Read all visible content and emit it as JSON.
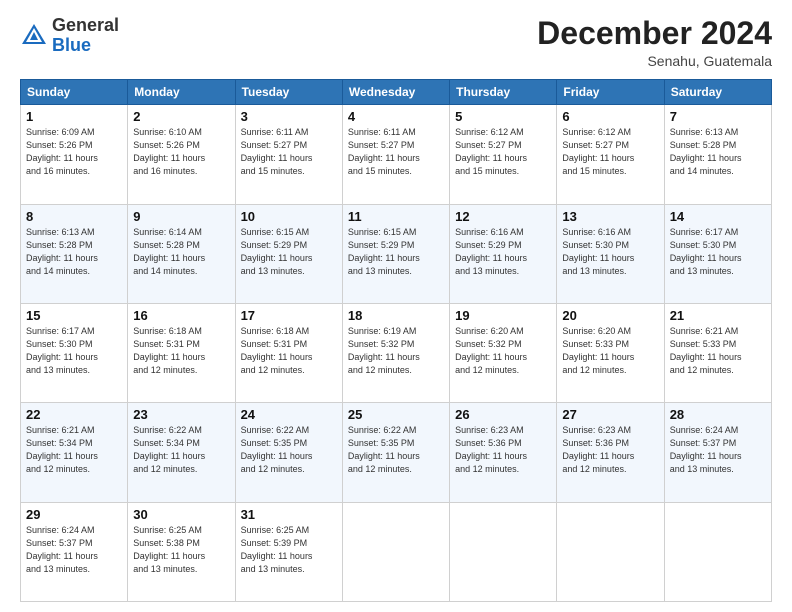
{
  "logo": {
    "general": "General",
    "blue": "Blue"
  },
  "header": {
    "title": "December 2024",
    "location": "Senahu, Guatemala"
  },
  "weekdays": [
    "Sunday",
    "Monday",
    "Tuesday",
    "Wednesday",
    "Thursday",
    "Friday",
    "Saturday"
  ],
  "weeks": [
    [
      {
        "day": "1",
        "info": "Sunrise: 6:09 AM\nSunset: 5:26 PM\nDaylight: 11 hours\nand 16 minutes."
      },
      {
        "day": "2",
        "info": "Sunrise: 6:10 AM\nSunset: 5:26 PM\nDaylight: 11 hours\nand 16 minutes."
      },
      {
        "day": "3",
        "info": "Sunrise: 6:11 AM\nSunset: 5:27 PM\nDaylight: 11 hours\nand 15 minutes."
      },
      {
        "day": "4",
        "info": "Sunrise: 6:11 AM\nSunset: 5:27 PM\nDaylight: 11 hours\nand 15 minutes."
      },
      {
        "day": "5",
        "info": "Sunrise: 6:12 AM\nSunset: 5:27 PM\nDaylight: 11 hours\nand 15 minutes."
      },
      {
        "day": "6",
        "info": "Sunrise: 6:12 AM\nSunset: 5:27 PM\nDaylight: 11 hours\nand 15 minutes."
      },
      {
        "day": "7",
        "info": "Sunrise: 6:13 AM\nSunset: 5:28 PM\nDaylight: 11 hours\nand 14 minutes."
      }
    ],
    [
      {
        "day": "8",
        "info": "Sunrise: 6:13 AM\nSunset: 5:28 PM\nDaylight: 11 hours\nand 14 minutes."
      },
      {
        "day": "9",
        "info": "Sunrise: 6:14 AM\nSunset: 5:28 PM\nDaylight: 11 hours\nand 14 minutes."
      },
      {
        "day": "10",
        "info": "Sunrise: 6:15 AM\nSunset: 5:29 PM\nDaylight: 11 hours\nand 13 minutes."
      },
      {
        "day": "11",
        "info": "Sunrise: 6:15 AM\nSunset: 5:29 PM\nDaylight: 11 hours\nand 13 minutes."
      },
      {
        "day": "12",
        "info": "Sunrise: 6:16 AM\nSunset: 5:29 PM\nDaylight: 11 hours\nand 13 minutes."
      },
      {
        "day": "13",
        "info": "Sunrise: 6:16 AM\nSunset: 5:30 PM\nDaylight: 11 hours\nand 13 minutes."
      },
      {
        "day": "14",
        "info": "Sunrise: 6:17 AM\nSunset: 5:30 PM\nDaylight: 11 hours\nand 13 minutes."
      }
    ],
    [
      {
        "day": "15",
        "info": "Sunrise: 6:17 AM\nSunset: 5:30 PM\nDaylight: 11 hours\nand 13 minutes."
      },
      {
        "day": "16",
        "info": "Sunrise: 6:18 AM\nSunset: 5:31 PM\nDaylight: 11 hours\nand 12 minutes."
      },
      {
        "day": "17",
        "info": "Sunrise: 6:18 AM\nSunset: 5:31 PM\nDaylight: 11 hours\nand 12 minutes."
      },
      {
        "day": "18",
        "info": "Sunrise: 6:19 AM\nSunset: 5:32 PM\nDaylight: 11 hours\nand 12 minutes."
      },
      {
        "day": "19",
        "info": "Sunrise: 6:20 AM\nSunset: 5:32 PM\nDaylight: 11 hours\nand 12 minutes."
      },
      {
        "day": "20",
        "info": "Sunrise: 6:20 AM\nSunset: 5:33 PM\nDaylight: 11 hours\nand 12 minutes."
      },
      {
        "day": "21",
        "info": "Sunrise: 6:21 AM\nSunset: 5:33 PM\nDaylight: 11 hours\nand 12 minutes."
      }
    ],
    [
      {
        "day": "22",
        "info": "Sunrise: 6:21 AM\nSunset: 5:34 PM\nDaylight: 11 hours\nand 12 minutes."
      },
      {
        "day": "23",
        "info": "Sunrise: 6:22 AM\nSunset: 5:34 PM\nDaylight: 11 hours\nand 12 minutes."
      },
      {
        "day": "24",
        "info": "Sunrise: 6:22 AM\nSunset: 5:35 PM\nDaylight: 11 hours\nand 12 minutes."
      },
      {
        "day": "25",
        "info": "Sunrise: 6:22 AM\nSunset: 5:35 PM\nDaylight: 11 hours\nand 12 minutes."
      },
      {
        "day": "26",
        "info": "Sunrise: 6:23 AM\nSunset: 5:36 PM\nDaylight: 11 hours\nand 12 minutes."
      },
      {
        "day": "27",
        "info": "Sunrise: 6:23 AM\nSunset: 5:36 PM\nDaylight: 11 hours\nand 12 minutes."
      },
      {
        "day": "28",
        "info": "Sunrise: 6:24 AM\nSunset: 5:37 PM\nDaylight: 11 hours\nand 13 minutes."
      }
    ],
    [
      {
        "day": "29",
        "info": "Sunrise: 6:24 AM\nSunset: 5:37 PM\nDaylight: 11 hours\nand 13 minutes."
      },
      {
        "day": "30",
        "info": "Sunrise: 6:25 AM\nSunset: 5:38 PM\nDaylight: 11 hours\nand 13 minutes."
      },
      {
        "day": "31",
        "info": "Sunrise: 6:25 AM\nSunset: 5:39 PM\nDaylight: 11 hours\nand 13 minutes."
      },
      null,
      null,
      null,
      null
    ]
  ]
}
